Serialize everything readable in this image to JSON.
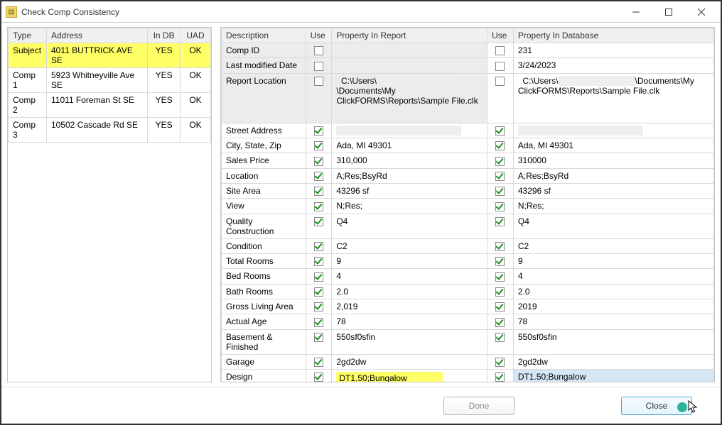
{
  "window": {
    "title": "Check Comp Consistency"
  },
  "leftTable": {
    "headers": {
      "type": "Type",
      "address": "Address",
      "indb": "In DB",
      "uad": "UAD"
    },
    "rows": [
      {
        "type": "Subject",
        "address": "4011 BUTTRICK AVE SE",
        "indb": "YES",
        "uad": "OK",
        "subject": true
      },
      {
        "type": "Comp 1",
        "address": "5923 Whitneyville Ave SE",
        "indb": "YES",
        "uad": "OK"
      },
      {
        "type": "Comp 2",
        "address": "11011 Foreman St SE",
        "indb": "YES",
        "uad": "OK"
      },
      {
        "type": "Comp 3",
        "address": "10502 Cascade Rd SE",
        "indb": "YES",
        "uad": "OK"
      }
    ]
  },
  "rightTable": {
    "headers": {
      "desc": "Description",
      "use1": "Use",
      "prop1": "Property In Report",
      "use2": "Use",
      "prop2": "Property In  Database"
    },
    "metaRows": [
      {
        "desc": "Comp ID",
        "use1": false,
        "prop1": "",
        "use2": false,
        "prop2": "231"
      },
      {
        "desc": "Last modified Date",
        "use1": false,
        "prop1": "",
        "use2": false,
        "prop2": "3/24/2023"
      },
      {
        "desc": "Report Location",
        "use1": false,
        "prop1_pre": "C:\\Users\\",
        "prop1_post": "\\Documents\\My ClickFORMS\\Reports\\Sample File.clk",
        "use2": false,
        "prop2_pre": "C:\\Users\\",
        "prop2_post": "\\Documents\\My ClickFORMS\\Reports\\Sample File.clk"
      }
    ],
    "rows": [
      {
        "desc": "Street Address",
        "prop1": "[redacted]",
        "prop2": "[redacted]",
        "redact": true
      },
      {
        "desc": "City, State, Zip",
        "prop1": "Ada, MI 49301",
        "prop2": "Ada, MI 49301"
      },
      {
        "desc": "Sales Price",
        "prop1": "310,000",
        "prop2": "310000"
      },
      {
        "desc": "Location",
        "prop1": "A;Res;BsyRd",
        "prop2": "A;Res;BsyRd"
      },
      {
        "desc": "Site Area",
        "prop1": "43296 sf",
        "prop2": "43296 sf"
      },
      {
        "desc": "View",
        "prop1": "N;Res;",
        "prop2": "N;Res;"
      },
      {
        "desc": "Quality Construction",
        "prop1": "Q4",
        "prop2": "Q4"
      },
      {
        "desc": "Condition",
        "prop1": "C2",
        "prop2": "C2"
      },
      {
        "desc": "Total Rooms",
        "prop1": "9",
        "prop2": "9"
      },
      {
        "desc": "Bed Rooms",
        "prop1": "4",
        "prop2": "4"
      },
      {
        "desc": "Bath Rooms",
        "prop1": "2.0",
        "prop2": "2.0"
      },
      {
        "desc": "Gross Living Area",
        "prop1": "2,019",
        "prop2": "2019"
      },
      {
        "desc": "Actual Age",
        "prop1": "78",
        "prop2": "78"
      },
      {
        "desc": "Basement & Finished",
        "prop1": "550sf0sfin",
        "prop2": "550sf0sfin"
      },
      {
        "desc": "Garage",
        "prop1": "2gd2dw",
        "prop2": "2gd2dw"
      },
      {
        "desc": "Design",
        "prop1": "DT1.50;Bungalow",
        "prop2": "DT1.50;Bungalow",
        "hl1": true,
        "hl2": true
      }
    ]
  },
  "buttons": {
    "done": "Done",
    "close": "Close"
  }
}
